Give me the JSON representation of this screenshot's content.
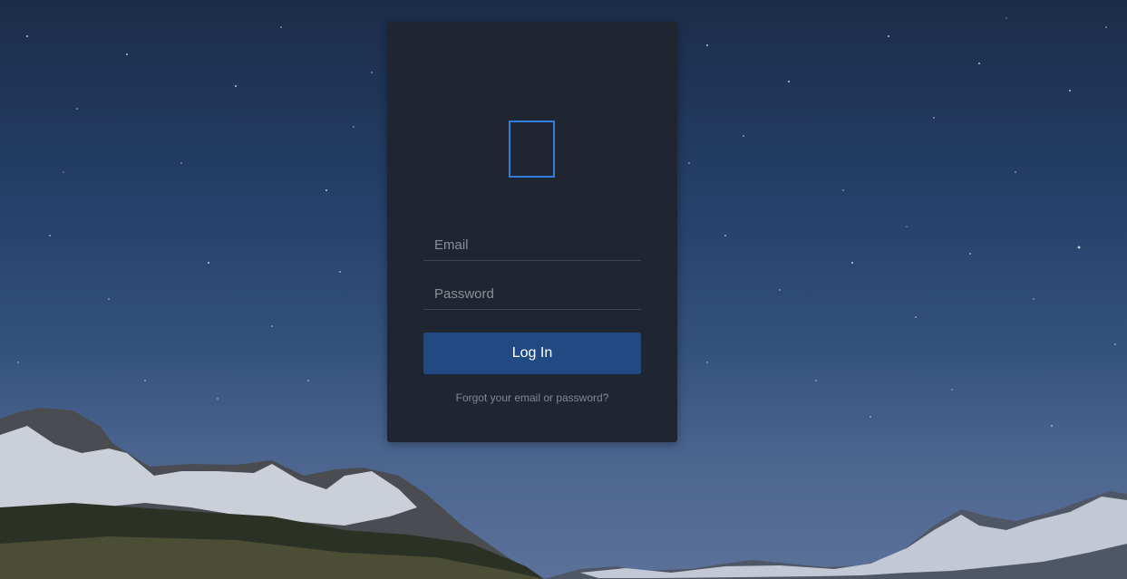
{
  "login": {
    "email_placeholder": "Email",
    "password_placeholder": "Password",
    "login_label": "Log In",
    "forgot_label": "Forgot your email or password?"
  },
  "colors": {
    "card": "#1f2631",
    "accent": "#2f7fe0",
    "button": "#224a82"
  }
}
